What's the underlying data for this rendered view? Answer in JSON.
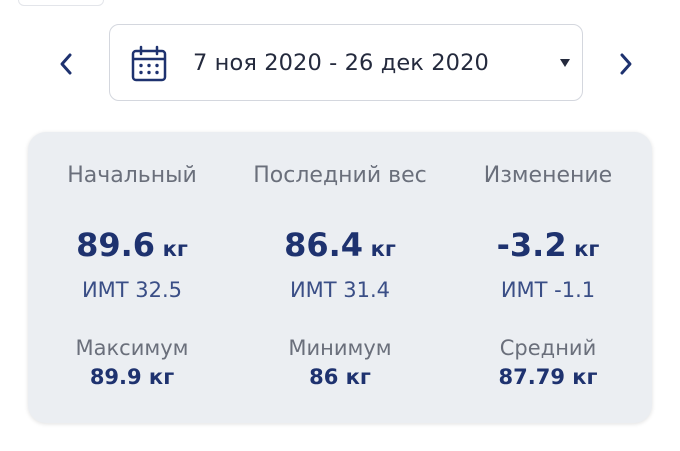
{
  "date_range": {
    "label": "7 ноя 2020 - 26 дек 2020"
  },
  "icons": {
    "prev": "chevron-left-icon",
    "next": "chevron-right-icon",
    "calendar": "calendar-icon",
    "dropdown": "dropdown-arrow-icon"
  },
  "colors": {
    "accent": "#1e326f",
    "card_background": "#ebeef2",
    "muted_text": "#6a6f7b"
  },
  "stats": [
    {
      "heading": "Начальный",
      "value": "89.6",
      "unit": "кг",
      "bmi": "ИМТ 32.5",
      "sub_label": "Максимум",
      "sub_value": "89.9 кг"
    },
    {
      "heading": "Последний вес",
      "value": "86.4",
      "unit": "кг",
      "bmi": "ИМТ 31.4",
      "sub_label": "Минимум",
      "sub_value": "86 кг"
    },
    {
      "heading": "Изменение",
      "value": "-3.2",
      "unit": "кг",
      "bmi": "ИМТ -1.1",
      "sub_label": "Средний",
      "sub_value": "87.79 кг"
    }
  ]
}
